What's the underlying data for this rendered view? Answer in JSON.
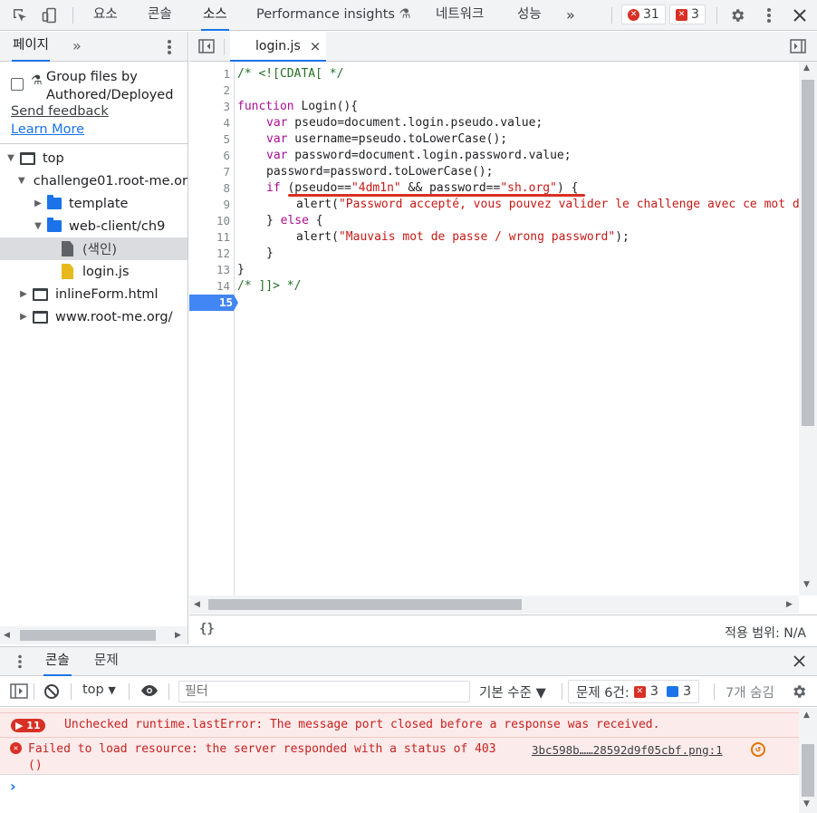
{
  "toolbar": {
    "tabs": [
      "요소",
      "콘솔",
      "소스",
      "Performance insights",
      "네트워크",
      "성능"
    ],
    "active_tab": "소스",
    "more": "»",
    "errors_count": "31",
    "issues_count": "3",
    "beaker": "⚗"
  },
  "sidebar": {
    "tab_label": "페이지",
    "more": "»",
    "group_files_label": "Group files by Authored/Deployed",
    "send_feedback": "Send feedback",
    "learn_more": "Learn More",
    "tree": [
      {
        "label": "top"
      },
      {
        "label": "challenge01.root-me.or"
      },
      {
        "label": "template"
      },
      {
        "label": "web-client/ch9"
      },
      {
        "label": "(색인)"
      },
      {
        "label": "login.js"
      },
      {
        "label": "inlineForm.html"
      },
      {
        "label": "www.root-me.org/"
      }
    ]
  },
  "editor": {
    "open_tab": "login.js",
    "close": "×",
    "line_numbers": [
      "1",
      "2",
      "3",
      "4",
      "5",
      "6",
      "7",
      "8",
      "9",
      "10",
      "11",
      "12",
      "13",
      "14",
      "15"
    ],
    "active_line": "15",
    "code": {
      "l1": "/* <![CDATA[ */",
      "l3_kw": "function",
      "l3_rest": " Login(){",
      "l4_kw": "var",
      "l4_rest": " pseudo=document.login.pseudo.value;",
      "l5_kw": "var",
      "l5_rest": " username=pseudo.toLowerCase();",
      "l6_kw": "var",
      "l6_rest": " password=document.login.password.value;",
      "l7": "password=password.toLowerCase();",
      "l8_kw": "if",
      "l8_a": " (pseudo==",
      "l8_s1": "\"4dm1n\"",
      "l8_b": " && password==",
      "l8_s2": "\"sh.org\"",
      "l8_c": ") {",
      "l9_a": "alert(",
      "l9_s": "\"Password accepté, vous pouvez valider le challenge avec ce mot de passe\"",
      "l10_a": "} ",
      "l10_kw": "else",
      "l10_b": " {",
      "l11_a": "alert(",
      "l11_s": "\"Mauvais mot de passe / wrong password\"",
      "l11_b": ");",
      "l12": "}",
      "l13": "}",
      "l14": "/* ]]> */"
    },
    "braces": "{}",
    "coverage": "적용 범위: N/A",
    "highlight_color": "#d93025"
  },
  "drawer": {
    "tabs": [
      "콘솔",
      "문제"
    ],
    "active_tab": "콘솔"
  },
  "console": {
    "context": "top",
    "filter_placeholder": "필터",
    "levels": "기본 수준 ▼",
    "issues_label": "문제 6건:",
    "issues_errors": "3",
    "issues_info": "3",
    "hidden": "7개 숨김",
    "messages": [
      {
        "count": "11",
        "text": "Unchecked runtime.lastError: The message port closed before a response was received."
      },
      {
        "text": "Failed to load resource: the server responded with a status of 403",
        "link": "3bc598b……28592d9f05cbf.png:1",
        "text2": "()"
      }
    ],
    "prompt": "›"
  }
}
